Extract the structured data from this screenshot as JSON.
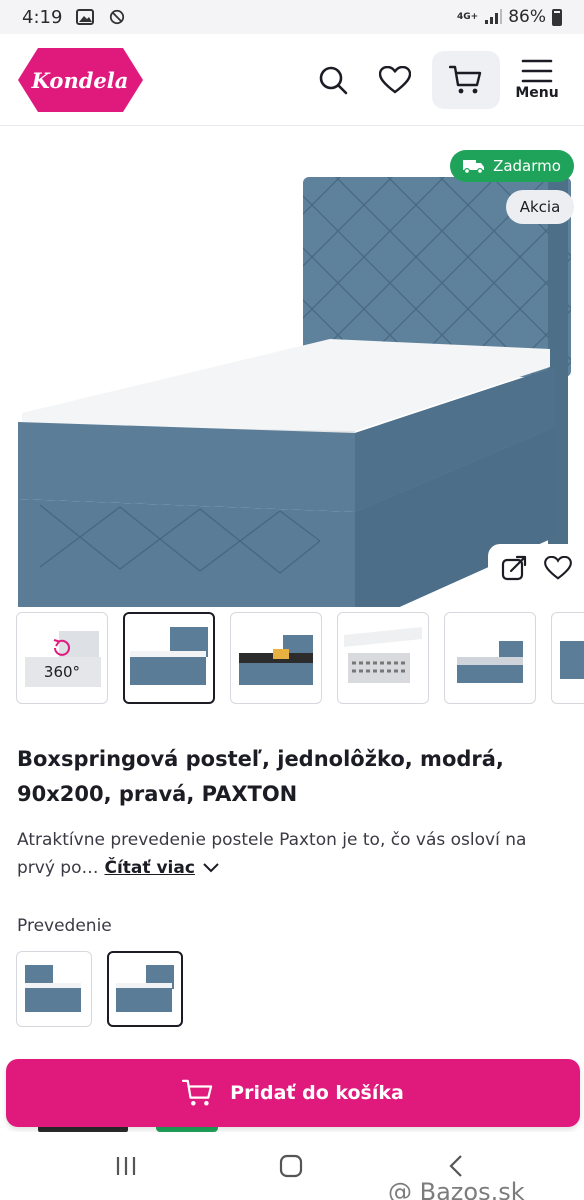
{
  "status_bar": {
    "time": "4:19",
    "network": "4G+",
    "battery": "86%"
  },
  "header": {
    "logo_text": "Kondela",
    "menu_label": "Menu"
  },
  "gallery": {
    "badge_free": "Zadarmo",
    "badge_sale": "Akcia",
    "thumb_360_label": "360°"
  },
  "product": {
    "title": "Boxspringová posteľ, jednolôžko, modrá, 90x200, pravá, PAXTON",
    "description": "Atraktívne prevedenie postele Paxton je to, čo vás osloví na prvý po…",
    "read_more": "Čítať viac"
  },
  "variants": {
    "label": "Prevedenie"
  },
  "cta": {
    "add_to_cart": "Pridať do košíka"
  },
  "watermark": "@ Bazos.sk",
  "colors": {
    "brand": "#e0197d",
    "success": "#1fa35a",
    "bed_blue": "#5b7d98"
  }
}
